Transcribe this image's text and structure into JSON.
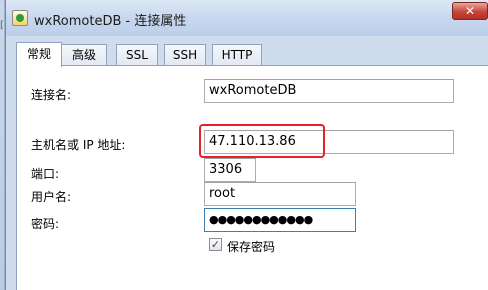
{
  "window": {
    "title": "wxRomoteDB - 连接属性",
    "close_glyph": "✕"
  },
  "tabs": [
    {
      "label": "常规",
      "active": true
    },
    {
      "label": "高级",
      "active": false
    },
    {
      "label": "SSL",
      "active": false
    },
    {
      "label": "SSH",
      "active": false
    },
    {
      "label": "HTTP",
      "active": false
    }
  ],
  "form": {
    "connection_name": {
      "label": "连接名:",
      "value": "wxRomoteDB"
    },
    "host": {
      "label": "主机名或 IP 地址:",
      "value": "47.110.13.86"
    },
    "port": {
      "label": "端口:",
      "value": "3306"
    },
    "username": {
      "label": "用户名:",
      "value": "root"
    },
    "password": {
      "label": "密码:",
      "value": "●●●●●●●●●●●●"
    },
    "save_password": {
      "label": "保存密码",
      "checked": true,
      "glyph": "✓"
    }
  },
  "icons": {
    "app": "database-connection-icon",
    "close": "close-icon",
    "checkbox": "checkmark-icon"
  },
  "colors": {
    "highlight": "#e5212a",
    "close_button": "#c8453b"
  }
}
